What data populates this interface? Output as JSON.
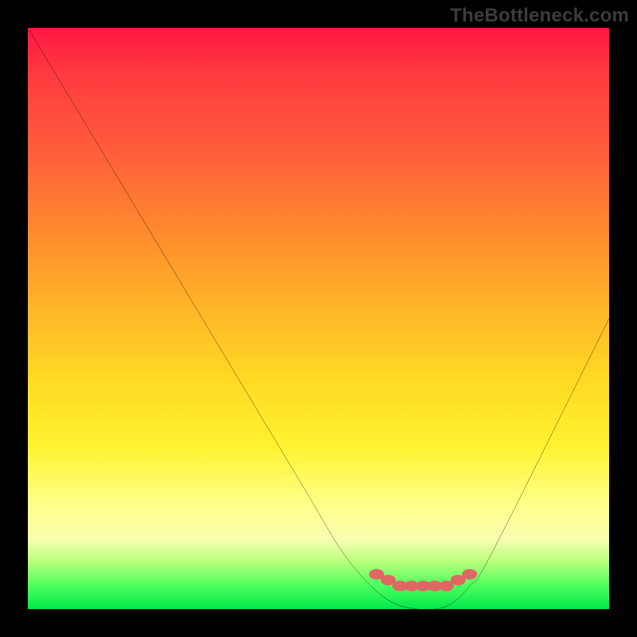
{
  "watermark": "TheBottleneck.com",
  "chart_data": {
    "type": "line",
    "title": "",
    "xlabel": "",
    "ylabel": "",
    "xlim": [
      0,
      100
    ],
    "ylim": [
      0,
      100
    ],
    "grid": false,
    "series": [
      {
        "name": "bottleneck-curve",
        "x": [
          0,
          6,
          12,
          18,
          24,
          30,
          36,
          42,
          48,
          54,
          59,
          63,
          67,
          70,
          73,
          76,
          80,
          100
        ],
        "values": [
          100,
          90,
          80,
          70,
          60,
          50,
          40,
          30,
          20,
          10,
          4,
          1,
          0,
          0,
          1,
          4,
          10,
          50
        ]
      }
    ],
    "markers": {
      "name": "bottom-dots",
      "color": "#e06664",
      "x": [
        60,
        62,
        64,
        66,
        68,
        70,
        72,
        74,
        76
      ],
      "values": [
        6,
        5,
        4,
        4,
        4,
        4,
        4,
        5,
        6
      ]
    },
    "background_gradient": {
      "top": "#ff1744",
      "mid": "#ffd824",
      "bottom": "#00e84a"
    }
  }
}
